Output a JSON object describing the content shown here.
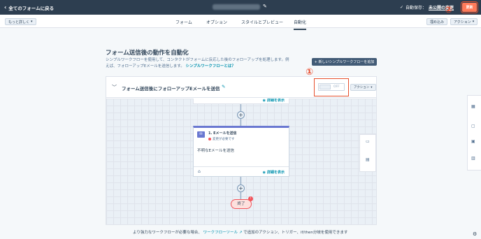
{
  "header": {
    "back_label": "全てのフォームに戻る",
    "autosave_label": "自動保存：",
    "autosave_status": "未公開の変更",
    "publish_label": "更新",
    "callout_2": "②"
  },
  "tabs": {
    "more_label": "もっと詳しく",
    "items": [
      "フォーム",
      "オプション",
      "スタイルとプレビュー",
      "自動化"
    ],
    "active": "自動化",
    "embed_label": "埋め込み",
    "actions_label": "アクション"
  },
  "main": {
    "heading": "フォーム送信後の動作を自動化",
    "desc_line1": "シンプルワークフローを使用して、コンタクトがフォームに反応した後のフォローアップを処理します。例",
    "desc_line2": "えば、フォローアップEメールを送信します。",
    "desc_link": "シンプルワークフローとは？",
    "new_workflow_button": "+ 新しいシンプルワークフローを追加"
  },
  "workflow": {
    "title": "フォーム送信後にフォローアップEメールを送信",
    "toggle_state": "OFF",
    "callout_1": "①",
    "actions_label": "アクション",
    "detail_label": "詳細を表示",
    "action_title": "1. Eメールを送信",
    "action_status": "変更が必要です",
    "action_body": "不明なEメールを送信",
    "end_label": "終了",
    "end_badge": "!"
  },
  "footer": {
    "text_before": "より強力なワークフローが必要な場合、",
    "link": "ワークフローツール",
    "text_after": "で追加のアクション、トリガー、if/then分岐を使用できます"
  }
}
